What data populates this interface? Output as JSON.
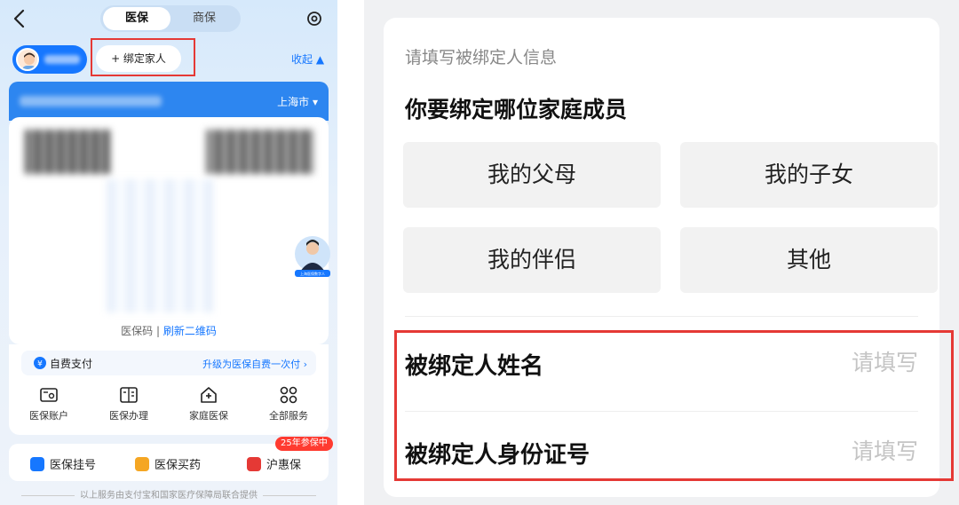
{
  "left_panel": {
    "tabs": [
      "医保",
      "商保"
    ],
    "bind_family_label": "+ 绑定家人",
    "collapse_label": "收起 ▲",
    "city": "上海市 ▾",
    "qr_caption_prefix": "医保码 |",
    "qr_refresh": "刷新二维码",
    "digital_person_caption": "上海医保数字人",
    "self_pay": {
      "label": "自费支付",
      "action": "升级为医保自费一次付 ›"
    },
    "services": [
      {
        "label": "医保账户",
        "icon": "account-card-icon"
      },
      {
        "label": "医保办理",
        "icon": "handling-doc-icon"
      },
      {
        "label": "家庭医保",
        "icon": "family-house-icon"
      },
      {
        "label": "全部服务",
        "icon": "grid-icon"
      }
    ],
    "bottom_items": [
      {
        "label": "医保挂号",
        "color": "#1677ff"
      },
      {
        "label": "医保买药",
        "color": "#f5a623"
      },
      {
        "label": "沪惠保",
        "color": "#e53935"
      }
    ],
    "badge": "25年参保中",
    "footnote": "以上服务由支付宝和国家医疗保障局联合提供"
  },
  "form": {
    "hint": "请填写被绑定人信息",
    "question": "你要绑定哪位家庭成员",
    "options": [
      "我的父母",
      "我的子女",
      "我的伴侣",
      "其他"
    ],
    "fields": [
      {
        "label": "被绑定人姓名",
        "placeholder": "请填写"
      },
      {
        "label": "被绑定人身份证号",
        "placeholder": "请填写"
      }
    ]
  },
  "colors": {
    "accent": "#1677ff",
    "highlight": "#e53935",
    "header_blue": "#2d86f0"
  }
}
